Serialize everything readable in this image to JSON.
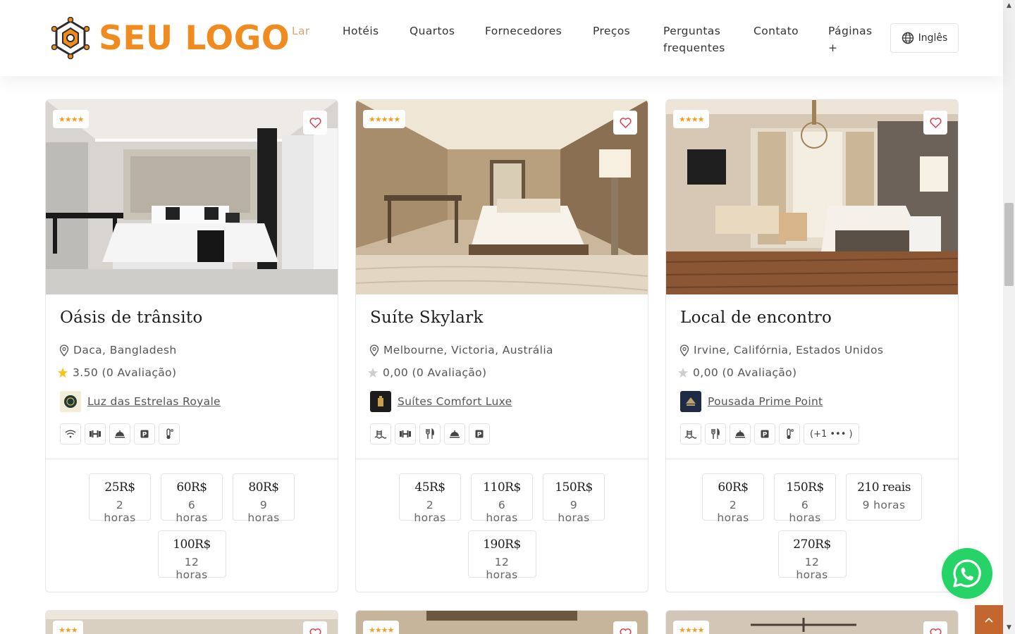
{
  "logo": {
    "text": "SEU LOGO"
  },
  "nav": {
    "items": [
      {
        "label": "Lar"
      },
      {
        "label": "Hotéis"
      },
      {
        "label": "Quartos"
      },
      {
        "label": "Fornecedores"
      },
      {
        "label": "Preços"
      },
      {
        "label": "Perguntas",
        "label2": "frequentes"
      },
      {
        "label": "Contato"
      },
      {
        "label": "Páginas",
        "label2": "+"
      }
    ],
    "language": "Inglês"
  },
  "cards": [
    {
      "stars": "★★★★",
      "title": "Oásis de trânsito",
      "location": "Daca, Bangladesh",
      "rating": "3.50 (0 Avaliação)",
      "vendor": "Luz das Estrelas Royale",
      "amenities": [
        "wifi-icon",
        "gym-icon",
        "room-service-icon",
        "parking-icon",
        "thermometer-icon"
      ],
      "prices": [
        {
          "value": "25R$",
          "duration": "2 horas"
        },
        {
          "value": "60R$",
          "duration": "6 horas"
        },
        {
          "value": "80R$",
          "duration": "9 horas"
        },
        {
          "value": "100R$",
          "duration": "12 horas"
        }
      ]
    },
    {
      "stars": "★★★★★",
      "title": "Suíte Skylark",
      "location": "Melbourne, Victoria, Austrália",
      "rating": "0,00 (0 Avaliação)",
      "vendor": "Suítes Comfort Luxe",
      "amenities": [
        "pool-icon",
        "gym-icon",
        "restaurant-icon",
        "room-service-icon",
        "parking-icon"
      ],
      "prices": [
        {
          "value": "45R$",
          "duration": "2 horas"
        },
        {
          "value": "110R$",
          "duration": "6 horas"
        },
        {
          "value": "150R$",
          "duration": "9 horas"
        },
        {
          "value": "190R$",
          "duration": "12 horas"
        }
      ]
    },
    {
      "stars": "★★★★",
      "title": "Local de encontro",
      "location": "Irvine, Califórnia, Estados Unidos",
      "rating": "0,00 (0 Avaliação)",
      "vendor": "Pousada Prime Point",
      "amenities": [
        "pool-icon",
        "restaurant-icon",
        "room-service-icon",
        "parking-icon",
        "thermometer-icon"
      ],
      "more_amenities": "(+1 ••• )",
      "prices": [
        {
          "value": "60R$",
          "duration": "2 horas"
        },
        {
          "value": "150R$",
          "duration": "6 horas"
        },
        {
          "value": "210 reais",
          "duration": "9 horas"
        },
        {
          "value": "270R$",
          "duration": "12 horas"
        }
      ]
    }
  ],
  "partial_cards": [
    {
      "stars": "★★★"
    },
    {
      "stars": "★★★★"
    },
    {
      "stars": "★★★★"
    }
  ],
  "colors": {
    "brand": "#f08c1f",
    "accent": "#c4672f",
    "whatsapp": "#25d366",
    "nav_active": "#d9a273",
    "fav_icon": "#e03a4c"
  }
}
